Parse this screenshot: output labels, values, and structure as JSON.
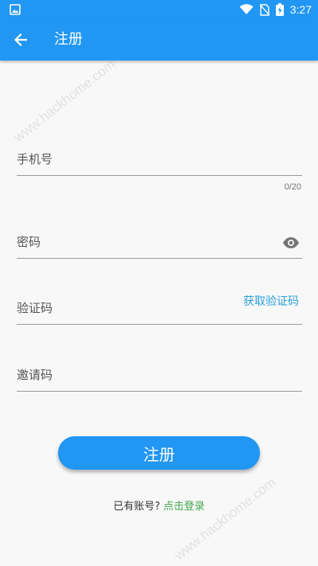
{
  "status_bar": {
    "time": "3:27"
  },
  "app_bar": {
    "back_icon": "arrow-left-icon",
    "title": "注册"
  },
  "form": {
    "phone": {
      "placeholder": "手机号",
      "value": "",
      "counter": "0/20"
    },
    "password": {
      "placeholder": "密码",
      "value": "",
      "toggle_icon": "eye-icon"
    },
    "verification_code": {
      "placeholder": "验证码",
      "value": "",
      "get_code_label": "获取验证码"
    },
    "invite_code": {
      "placeholder": "邀请码",
      "value": ""
    }
  },
  "register_button": {
    "label": "注册"
  },
  "login_prompt": {
    "text": "已有账号?",
    "link": "点击登录"
  },
  "watermark": {
    "text": "www.hackhome.com"
  },
  "colors": {
    "primary": "#2196f3",
    "link_blue": "#2d9fdb",
    "link_green": "#3ea84b",
    "background": "#f8f8f8"
  }
}
